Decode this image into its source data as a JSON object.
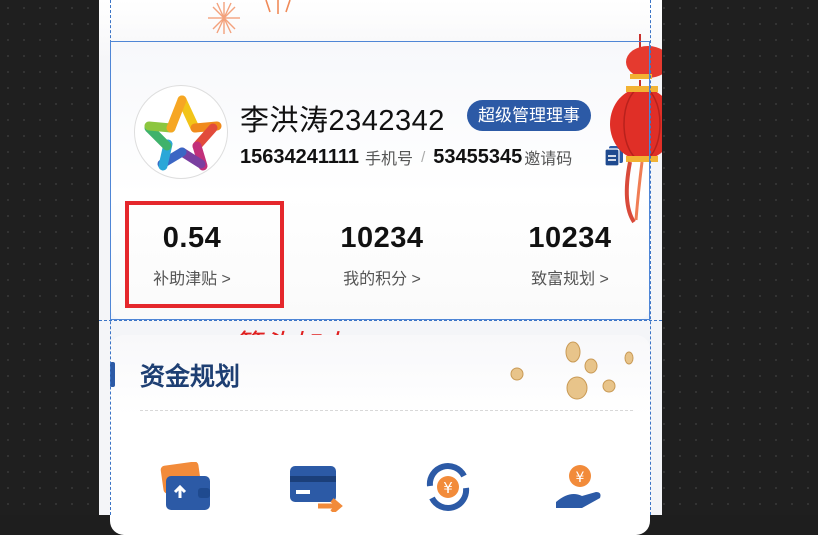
{
  "user": {
    "name": "李洪涛2342342",
    "role_badge": "超级管理理事",
    "phone": "15634241111",
    "phone_label": "手机号",
    "separator": "/",
    "invite_code": "53455345",
    "invite_label": "邀请码"
  },
  "stats": [
    {
      "value": "0.54",
      "label": "补助津贴 >"
    },
    {
      "value": "10234",
      "label": "我的积分 >"
    },
    {
      "value": "10234",
      "label": "致富规划 >"
    }
  ],
  "annotation": "箭头加上",
  "funds": {
    "title": "资金规划",
    "icons": [
      "wallet-icon",
      "card-transfer-icon",
      "yuan-exchange-icon",
      "hand-coin-icon"
    ]
  },
  "colors": {
    "brand_blue": "#2c5aa6",
    "highlight_red": "#e5272c",
    "annotation_red": "#e02020"
  }
}
